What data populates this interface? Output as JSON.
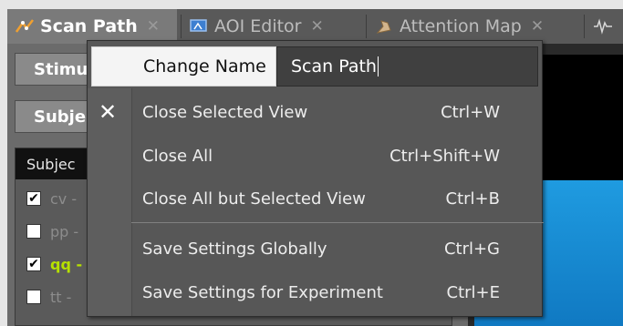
{
  "tabs": [
    {
      "label": "Scan Path",
      "icon": "scan-path-icon",
      "active": true
    },
    {
      "label": "AOI Editor",
      "icon": "aoi-editor-icon",
      "active": false
    },
    {
      "label": "Attention Map",
      "icon": "attention-map-icon",
      "active": false
    }
  ],
  "left_panel": {
    "stimulus_label": "Stimu",
    "subjects_label": "Subje",
    "list_header": "Subjec",
    "rows": [
      {
        "text": "cv -",
        "checked": true,
        "color": "#8c8c8c"
      },
      {
        "text": "pp -",
        "checked": false,
        "color": "#8c8c8c"
      },
      {
        "text": "qq -",
        "checked": true,
        "color": "#b6e000"
      },
      {
        "text": "tt -",
        "checked": false,
        "color": "#8c8c8c"
      }
    ]
  },
  "context_menu": {
    "change_name_label": "Change Name",
    "name_value": "Scan Path",
    "items": [
      {
        "label": "Close Selected View",
        "shortcut": "Ctrl+W"
      },
      {
        "label": "Close All",
        "shortcut": "Ctrl+Shift+W"
      },
      {
        "label": "Close All but Selected View",
        "shortcut": "Ctrl+B"
      },
      {
        "label": "Save Settings Globally",
        "shortcut": "Ctrl+G"
      },
      {
        "label": "Save Settings for Experiment",
        "shortcut": "Ctrl+E"
      }
    ]
  },
  "colors": {
    "accent_green": "#b6e000",
    "swatch_orange": "#ff7f50",
    "viewer_blue": "#1f9be0"
  }
}
